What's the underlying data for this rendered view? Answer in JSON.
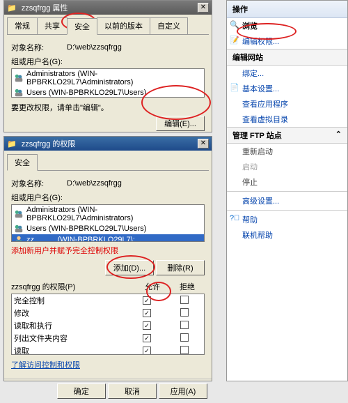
{
  "dlg1": {
    "title_prefix": "zzsqfrgg",
    "title_suffix": "属性",
    "tabs": [
      "常规",
      "共享",
      "安全",
      "以前的版本",
      "自定义"
    ],
    "active_tab_idx": 2,
    "object_label": "对象名称:",
    "object_path": "D:\\web\\zzsqfrgg",
    "group_label": "组或用户名(G):",
    "items": [
      "Administrators (WIN-BPBRKLO29L7\\Administrators)",
      "Users (WIN-BPBRKLO29L7\\Users)"
    ],
    "hint": "要更改权限，请单击\"编辑\"。",
    "edit_btn": "编辑(E)..."
  },
  "dlg2": {
    "title": "zzsqfrgg 的权限",
    "tab": "安全",
    "object_label": "对象名称:",
    "object_path": "D:\\web\\zzsqfrgg",
    "group_label": "组或用户名(G):",
    "items": [
      {
        "text": "Administrators (WIN-BPBRKLO29L7\\Administrators)",
        "sel": false
      },
      {
        "text": "Users (WIN-BPBRKLO29L7\\Users)",
        "sel": false
      },
      {
        "text": "zz_____ (WIN-BPBRKLO29L7\\:",
        "sel": true
      }
    ],
    "red_note": "添加新用户并赋予完全控制权限",
    "add_btn": "添加(D)...",
    "remove_btn": "删除(R)",
    "perm_header": "zzsqfrgg 的权限(P)",
    "allow": "允许",
    "deny": "拒绝",
    "perms": [
      {
        "name": "完全控制",
        "allow": true,
        "deny": false
      },
      {
        "name": "修改",
        "allow": true,
        "deny": false
      },
      {
        "name": "读取和执行",
        "allow": true,
        "deny": false
      },
      {
        "name": "列出文件夹内容",
        "allow": true,
        "deny": false
      },
      {
        "name": "读取",
        "allow": true,
        "deny": false
      }
    ],
    "learn_link": "了解访问控制和权限",
    "ok": "确定",
    "cancel": "取消",
    "apply": "应用(A)"
  },
  "right": {
    "header": "操作",
    "items1": [
      {
        "label": "浏览",
        "icon": "browse",
        "link": false
      },
      {
        "label": "编辑权限...",
        "icon": "edit",
        "link": true
      }
    ],
    "sub1": "编辑网站",
    "items2": [
      {
        "label": "绑定...",
        "icon": "bind"
      },
      {
        "label": "基本设置...",
        "icon": "settings"
      }
    ],
    "items3": [
      {
        "label": "查看应用程序",
        "icon": ""
      },
      {
        "label": "查看虚拟目录",
        "icon": ""
      }
    ],
    "sub2": "管理 FTP 站点",
    "items4": [
      {
        "label": "重新启动",
        "icon": ""
      },
      {
        "label": "启动",
        "icon": "",
        "dim": true
      },
      {
        "label": "停止",
        "icon": ""
      }
    ],
    "adv": "高级设置...",
    "help": [
      {
        "label": "帮助",
        "icon": "help"
      },
      {
        "label": "联机帮助",
        "icon": ""
      }
    ]
  }
}
